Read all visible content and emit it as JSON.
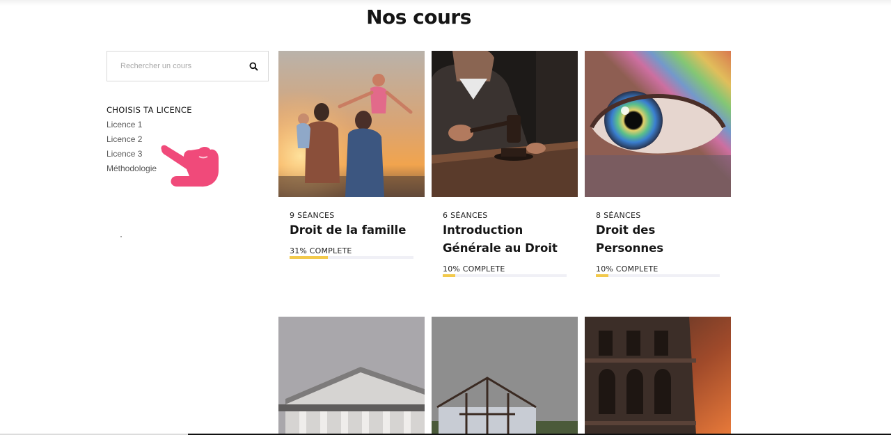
{
  "page": {
    "title": "Nos cours"
  },
  "search": {
    "placeholder": "Rechercher un cours"
  },
  "filter": {
    "heading": "CHOISIS TA LICENCE",
    "items": [
      "Licence 1",
      "Licence 2",
      "Licence 3",
      "Méthodologie"
    ]
  },
  "courses": [
    {
      "sessions": "9 SÉANCES",
      "title": "Droit de la famille",
      "progress_label": "31% COMPLETE",
      "progress": 0.31,
      "image": "family-sunset-photo"
    },
    {
      "sessions": "6 SÉANCES",
      "title": "Introduction Générale au Droit",
      "progress_label": "10% COMPLETE",
      "progress": 0.1,
      "image": "judge-gavel-photo"
    },
    {
      "sessions": "8 SÉANCES",
      "title": "Droit des Personnes",
      "progress_label": "10% COMPLETE",
      "progress": 0.1,
      "image": "rainbow-eye-photo"
    },
    {
      "image": "greek-temple-photo"
    },
    {
      "image": "house-frame-photo"
    },
    {
      "image": "colosseum-photo"
    }
  ],
  "colors": {
    "progress_fill": "#f2c94c",
    "progress_track": "#f0f0f6",
    "pointer": "#f04a7a"
  }
}
